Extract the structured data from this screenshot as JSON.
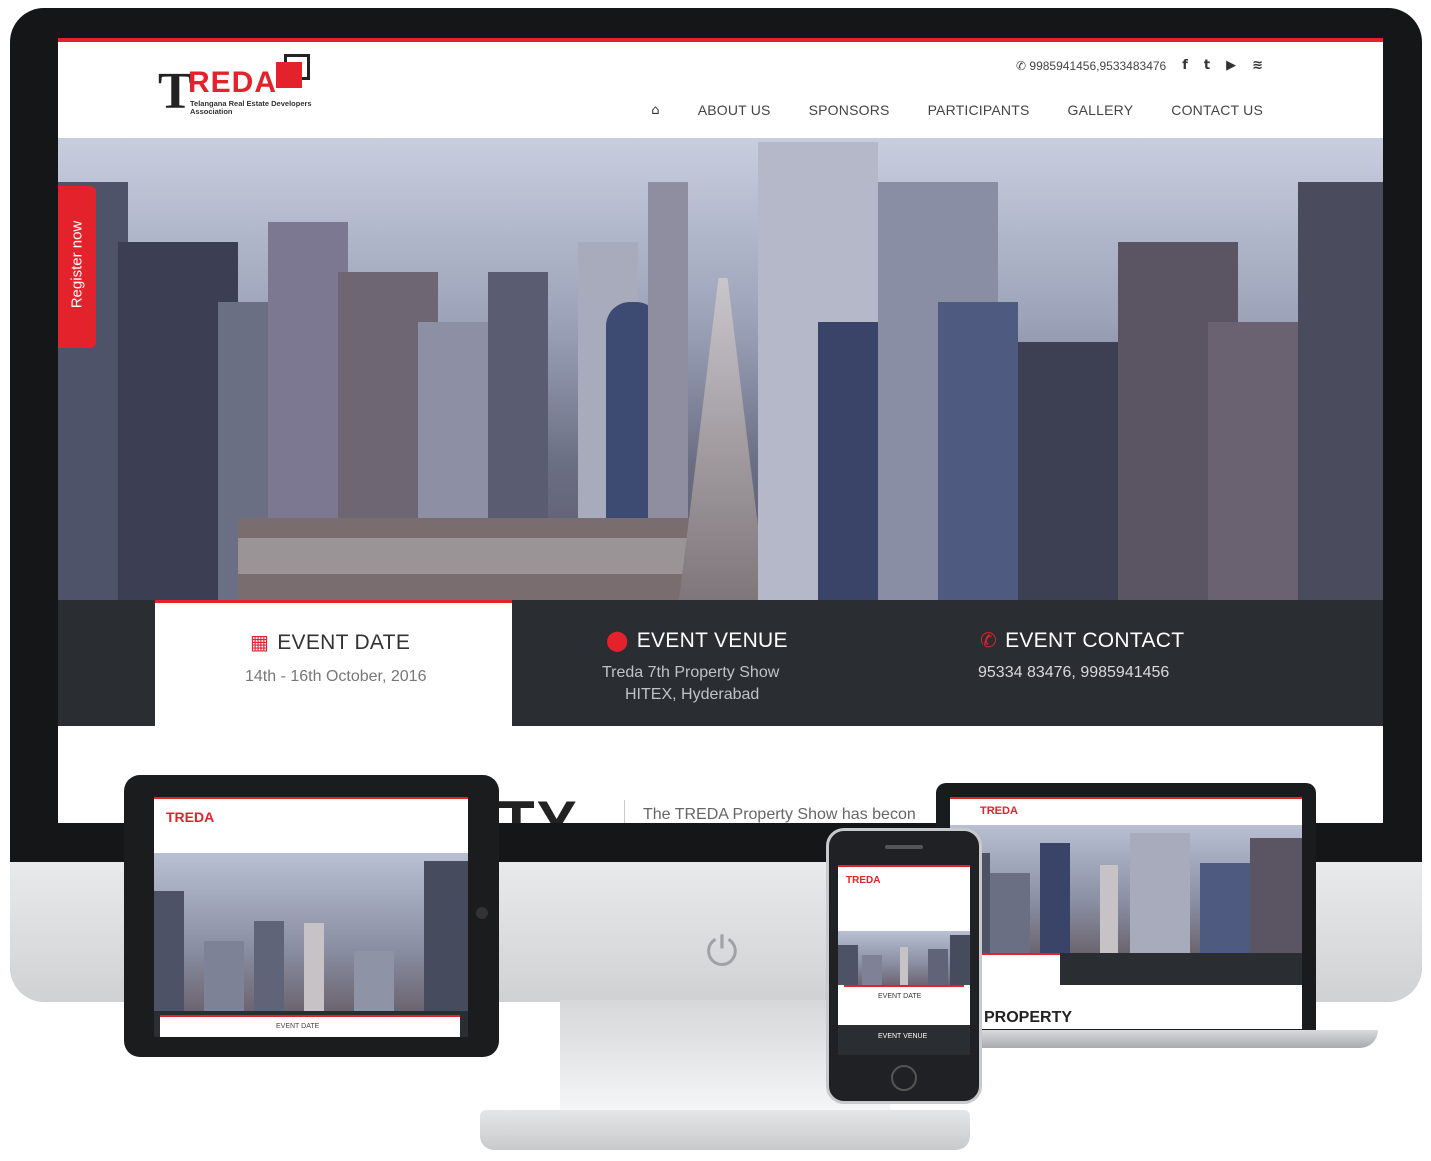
{
  "brand": {
    "logo_t": "T",
    "logo_reda": "REDA",
    "logo_sub": "Telangana Real Estate Developers Association"
  },
  "header": {
    "phone": "9985941456,9533483476",
    "social_icons": [
      "facebook-icon",
      "twitter-icon",
      "youtube-icon",
      "rss-icon"
    ],
    "social_glyphs": [
      "f",
      "t",
      "▶",
      "≋"
    ]
  },
  "nav": {
    "home_glyph": "⌂",
    "items": [
      "ABOUT US",
      "SPONSORS",
      "PARTICIPANTS",
      "GALLERY",
      "CONTACT US"
    ]
  },
  "register_tab": "Register now",
  "event": {
    "date_title": "EVENT DATE",
    "date_value": "14th - 16th October, 2016",
    "venue_title": "EVENT VENUE",
    "venue_line1": "Treda 7th Property Show",
    "venue_line2": "HITEX, Hyderabad",
    "contact_title": "EVENT CONTACT",
    "contact_value": "95334 83476, 9985941456"
  },
  "below": {
    "big_text": "TY",
    "intro_text": "The TREDA Property Show has becon"
  },
  "tablet": {
    "logo": "TREDA",
    "strip_label": "EVENT DATE"
  },
  "phone_device": {
    "logo": "TREDA",
    "date_label": "EVENT DATE",
    "venue_label": "EVENT VENUE"
  },
  "laptop": {
    "logo": "TREDA",
    "heading": "PROPERTY"
  },
  "colors": {
    "accent": "#e3222c",
    "strip": "#2a2d31"
  }
}
